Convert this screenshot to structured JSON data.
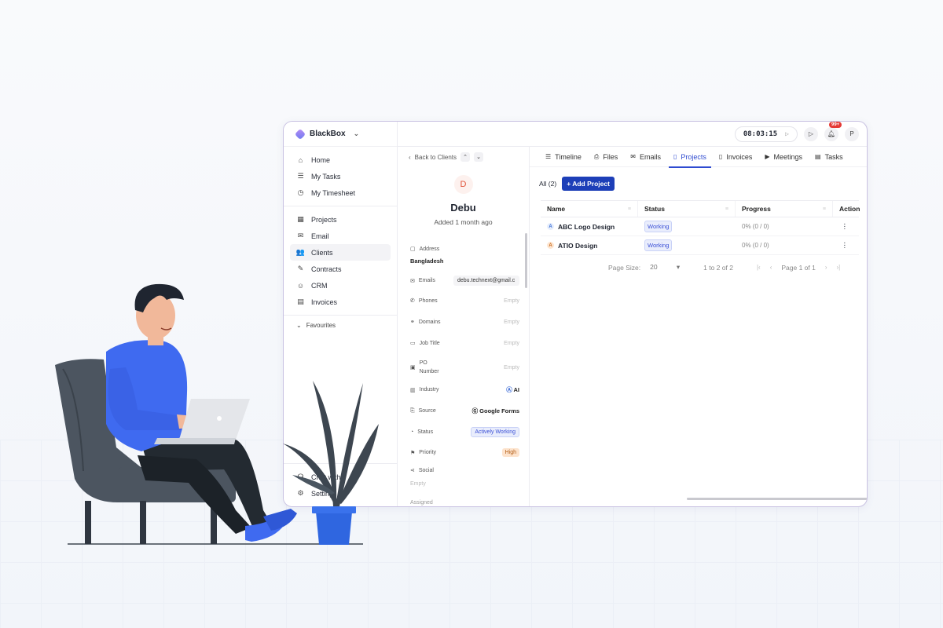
{
  "app": {
    "name": "BlackBox",
    "timer": "08:03:15",
    "notifications_badge": "99+",
    "user_initial": "P"
  },
  "sidebar": {
    "group1": [
      {
        "label": "Home",
        "icon": "home-icon"
      },
      {
        "label": "My Tasks",
        "icon": "tasks-icon"
      },
      {
        "label": "My Timesheet",
        "icon": "timesheet-icon"
      }
    ],
    "group2": [
      {
        "label": "Projects",
        "icon": "projects-icon"
      },
      {
        "label": "Email",
        "icon": "mail-icon"
      },
      {
        "label": "Clients",
        "icon": "clients-icon",
        "active": true
      },
      {
        "label": "Contracts",
        "icon": "contracts-icon"
      },
      {
        "label": "CRM",
        "icon": "crm-icon"
      },
      {
        "label": "Invoices",
        "icon": "invoices-icon"
      }
    ],
    "favourites": "Favourites",
    "bottom": [
      {
        "label": "Chat with",
        "icon": "headset-icon"
      },
      {
        "label": "Settings",
        "icon": "sliders-icon"
      }
    ]
  },
  "client": {
    "back": "Back to Clients",
    "initial": "D",
    "name": "Debu",
    "added": "Added 1 month ago",
    "address_label": "Address",
    "address_value": "Bangladesh",
    "emails_label": "Emails",
    "emails_value": "debu.technext@gmail.c",
    "phones_label": "Phones",
    "domains_label": "Domains",
    "job_title_label": "Job Title",
    "po_label": "PO",
    "po_label2": "Number",
    "industry_label": "Industry",
    "industry_value": "AI",
    "source_label": "Source",
    "source_value": "Google Forms",
    "status_label": "Status",
    "status_value": "Actively Working",
    "priority_label": "Priority",
    "priority_value": "High",
    "social_label": "Social",
    "empty": "Empty",
    "assigned_label": "Assigned"
  },
  "tabs": [
    {
      "label": "Timeline",
      "icon": "list-icon"
    },
    {
      "label": "Files",
      "icon": "paperclip-icon"
    },
    {
      "label": "Emails",
      "icon": "mail-icon"
    },
    {
      "label": "Projects",
      "icon": "document-icon",
      "active": true
    },
    {
      "label": "Invoices",
      "icon": "file-icon"
    },
    {
      "label": "Meetings",
      "icon": "video-icon"
    },
    {
      "label": "Tasks",
      "icon": "clipboard-icon"
    }
  ],
  "projects": {
    "all_label": "All (2)",
    "add_button": "Add Project",
    "columns": [
      "Name",
      "Status",
      "Progress",
      "Action"
    ],
    "rows": [
      {
        "icon_letter": "A",
        "icon_color": "#3b6fd6",
        "icon_bg": "#e6eefc",
        "name": "ABC Logo Design",
        "status": "Working",
        "progress": "0% (0 / 0)"
      },
      {
        "icon_letter": "A",
        "icon_color": "#c96a1b",
        "icon_bg": "#fde6d2",
        "name": "ATIO Design",
        "status": "Working",
        "progress": "0% (0 / 0)"
      }
    ],
    "pager": {
      "page_size_label": "Page Size:",
      "page_size": "20",
      "range": "1 to 2 of 2",
      "page": "Page 1 of 1"
    }
  },
  "colors": {
    "accent": "#1d3fb8",
    "window_border": "#c9c2e2",
    "person_shirt": "#3f6af0",
    "chair": "#4c5560",
    "plant_leaves": "#3d4650",
    "pot": "#2f66e0"
  }
}
